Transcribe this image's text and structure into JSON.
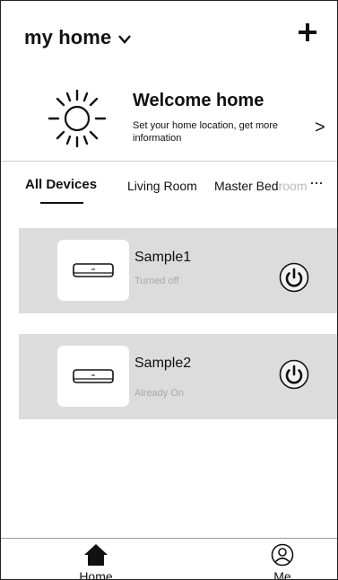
{
  "header": {
    "home_name": "my home",
    "add_icon": "plus-icon",
    "dropdown_icon": "chevron-down-icon"
  },
  "welcome": {
    "title": "Welcome home",
    "subtitle": "Set your home location, get more information",
    "arrow": ">",
    "icon": "sun-icon"
  },
  "tabs": {
    "items": [
      {
        "label": "All Devices",
        "active": true
      },
      {
        "label": "Living Room",
        "active": false
      },
      {
        "label_visible": "Master Bed",
        "label_faded": "room"
      }
    ],
    "more": "···"
  },
  "devices": [
    {
      "name": "Sample1",
      "status": "Turned off",
      "icon": "air-conditioner-icon",
      "power_icon": "power-icon"
    },
    {
      "name": "Sample2",
      "status": "Already On",
      "icon": "air-conditioner-icon",
      "power_icon": "power-icon"
    }
  ],
  "bottom_nav": {
    "items": [
      {
        "label": "Home",
        "icon": "home-icon",
        "active": true
      },
      {
        "label": "Me",
        "icon": "user-icon",
        "active": false
      }
    ]
  },
  "colors": {
    "card_background": "#dcdcdc",
    "status_text": "#a8a8a8",
    "accent": "#111111"
  }
}
